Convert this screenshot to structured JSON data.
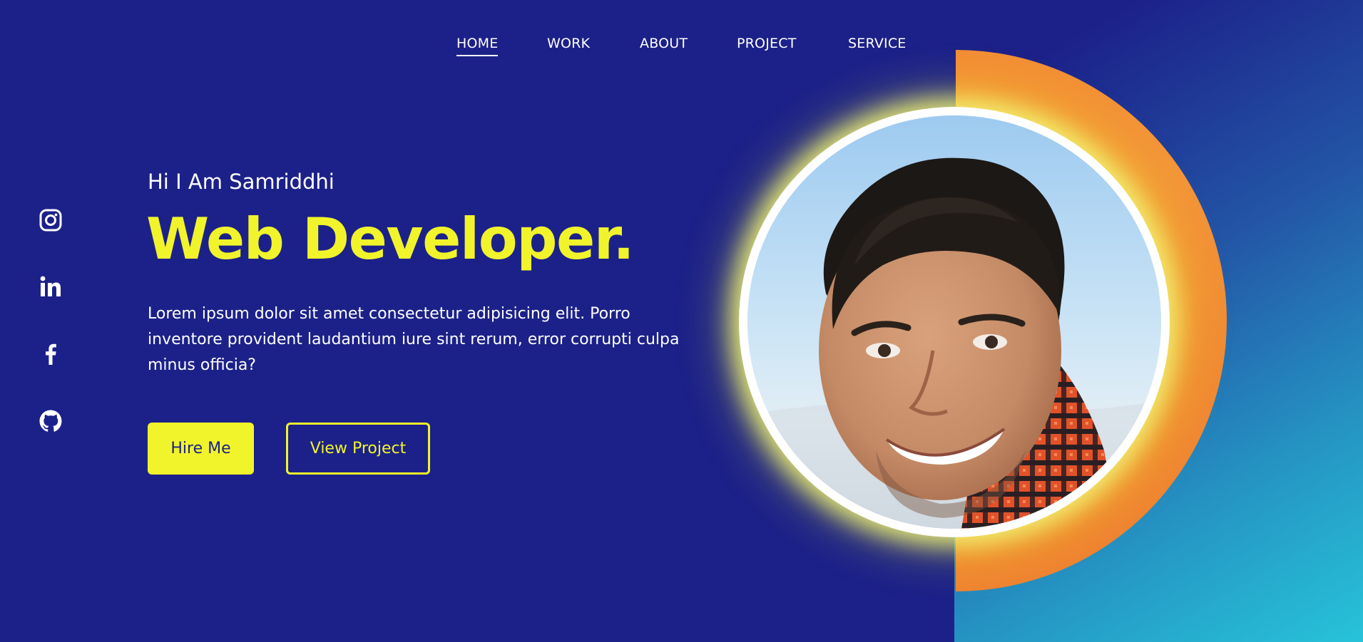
{
  "nav": {
    "items": [
      {
        "label": "HOME",
        "active": true
      },
      {
        "label": "WORK",
        "active": false
      },
      {
        "label": "ABOUT",
        "active": false
      },
      {
        "label": "PROJECT",
        "active": false
      },
      {
        "label": "SERVICE",
        "active": false
      }
    ]
  },
  "socials": [
    {
      "icon": "instagram-icon"
    },
    {
      "icon": "linkedin-icon"
    },
    {
      "icon": "facebook-icon"
    },
    {
      "icon": "github-icon"
    }
  ],
  "hero": {
    "greeting": "Hi I Am Samriddhi",
    "title": "Web Developer.",
    "bio": "Lorem ipsum dolor sit amet consectetur adipisicing elit. Porro inventore provident laudantium iure sint rerum, error corrupti culpa minus officia?",
    "hire_label": "Hire Me",
    "project_label": "View Project"
  },
  "colors": {
    "background": "#1c2189",
    "accent_yellow": "#f1f42b",
    "accent_orange": "#f28933",
    "gradient_end": "#27c3d9",
    "text": "#ffffff"
  }
}
